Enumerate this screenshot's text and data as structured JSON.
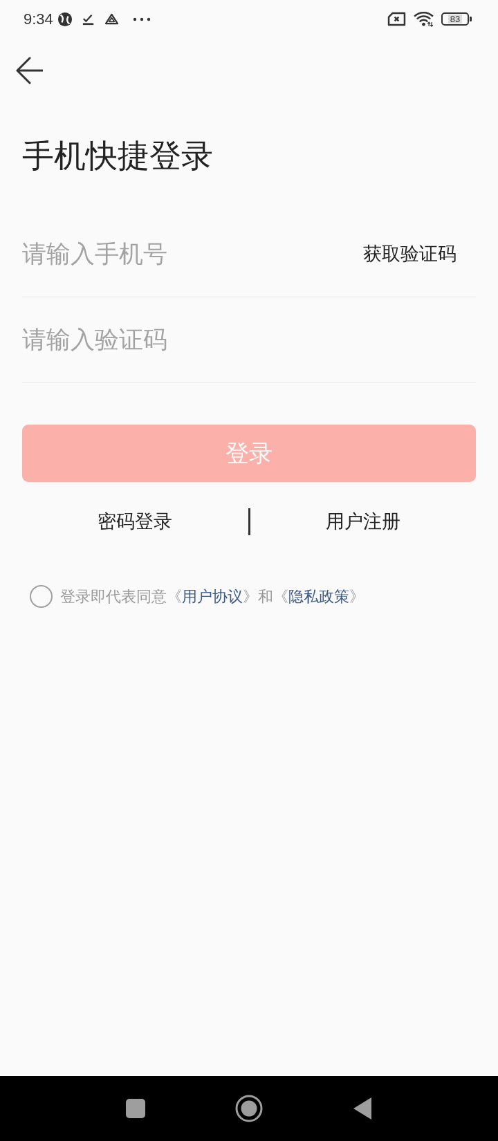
{
  "status_bar": {
    "time": "9:34",
    "battery": "83"
  },
  "title": "手机快捷登录",
  "phone_field": {
    "placeholder": "请输入手机号",
    "action": "获取验证码"
  },
  "code_field": {
    "placeholder": "请输入验证码"
  },
  "login_button": {
    "label": "登录",
    "disabled": true
  },
  "links": [
    "密码登录",
    "用户注册"
  ],
  "agreement": {
    "checked": false,
    "parts": [
      {
        "kind": "text",
        "text": "登录即代表同意《"
      },
      {
        "kind": "link",
        "text": "用户协议"
      },
      {
        "kind": "text",
        "text": "》和《"
      },
      {
        "kind": "link",
        "text": "隐私政策"
      },
      {
        "kind": "text",
        "text": "》"
      }
    ]
  }
}
